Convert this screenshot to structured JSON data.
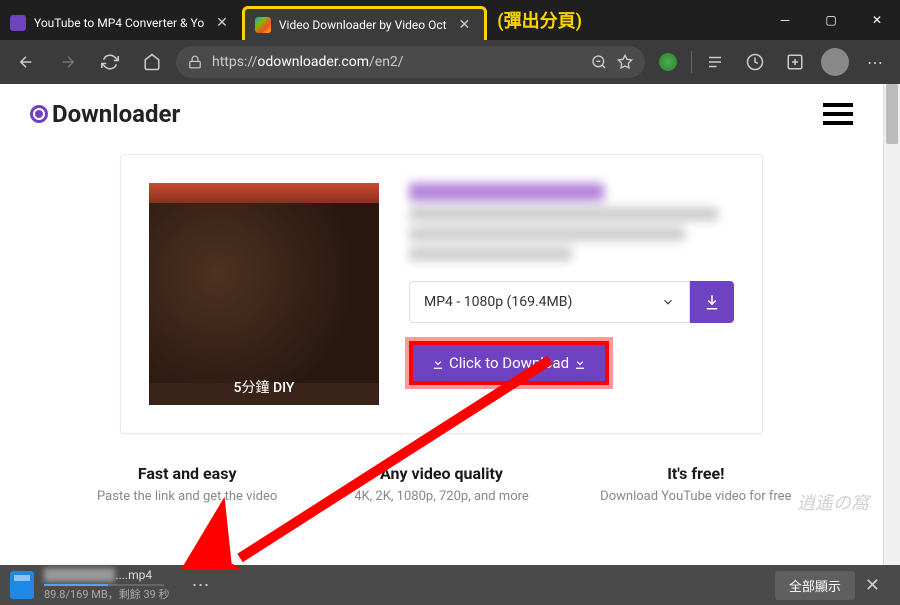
{
  "tabs": [
    {
      "title": "YouTube to MP4 Converter & Yo",
      "active": false
    },
    {
      "title": "Video Downloader by Video Oct",
      "active": true
    }
  ],
  "popup_annotation": "(彈出分頁)",
  "address_bar": {
    "scheme": "https://",
    "host": "odownloader.com",
    "path": "/en2/"
  },
  "page": {
    "logo": "Downloader",
    "thumb_caption": "5分鐘 DIY",
    "select_label": "MP4 - 1080p (169.4MB)",
    "click_download": "Click to Download",
    "features": [
      {
        "title": "Fast and easy",
        "desc": "Paste the link and get the video"
      },
      {
        "title": "Any video quality",
        "desc": "4K, 2K, 1080p, 720p, and more"
      },
      {
        "title": "It's free!",
        "desc": "Download YouTube video for free"
      }
    ],
    "watermark": "逍遙の窩"
  },
  "download_bar": {
    "filename": "....mp4",
    "progress": "89.8/169 MB，剩餘 39 秒",
    "show_all": "全部顯示"
  }
}
